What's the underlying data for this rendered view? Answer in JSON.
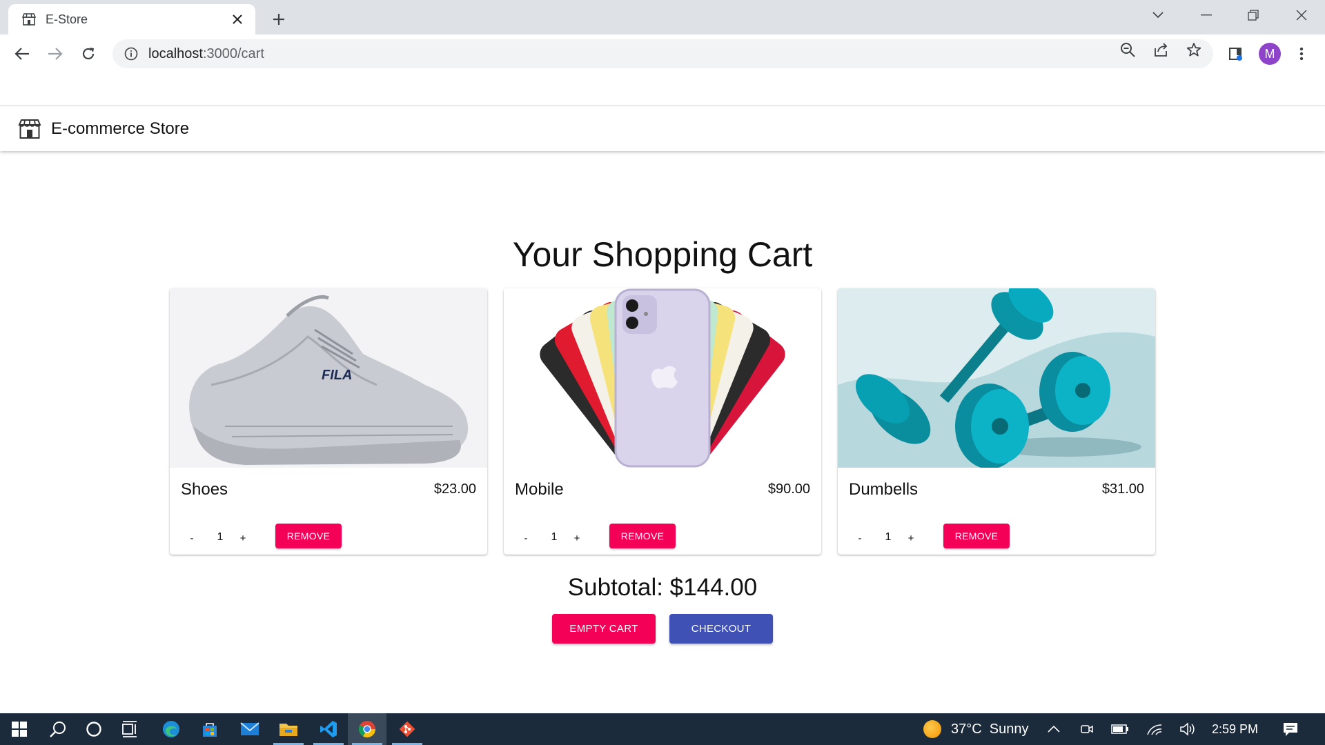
{
  "browser": {
    "tab_title": "E-Store",
    "url_host": "localhost",
    "url_path": ":3000/cart",
    "profile_initial": "M"
  },
  "app": {
    "store_name": "E-commerce Store",
    "page_title": "Your Shopping Cart"
  },
  "cart": {
    "items": [
      {
        "name": "Shoes",
        "price": "$23.00",
        "quantity": "1",
        "minus": "-",
        "plus": "+",
        "remove_label": "REMOVE"
      },
      {
        "name": "Mobile",
        "price": "$90.00",
        "quantity": "1",
        "minus": "-",
        "plus": "+",
        "remove_label": "REMOVE"
      },
      {
        "name": "Dumbells",
        "price": "$31.00",
        "quantity": "1",
        "minus": "-",
        "plus": "+",
        "remove_label": "REMOVE"
      }
    ],
    "subtotal": "Subtotal: $144.00",
    "empty_label": "EMPTY CART",
    "checkout_label": "CHECKOUT"
  },
  "colors": {
    "secondary": "#f50057",
    "primary": "#3f51b5"
  },
  "taskbar": {
    "weather": "37°C  Sunny",
    "time": "2:59 PM",
    "icons": [
      "windows-start-icon",
      "search-icon",
      "cortana-icon",
      "task-view-icon",
      "edge-icon",
      "store-icon",
      "mail-icon",
      "file-explorer-icon",
      "vscode-icon",
      "chrome-icon",
      "git-icon"
    ]
  }
}
